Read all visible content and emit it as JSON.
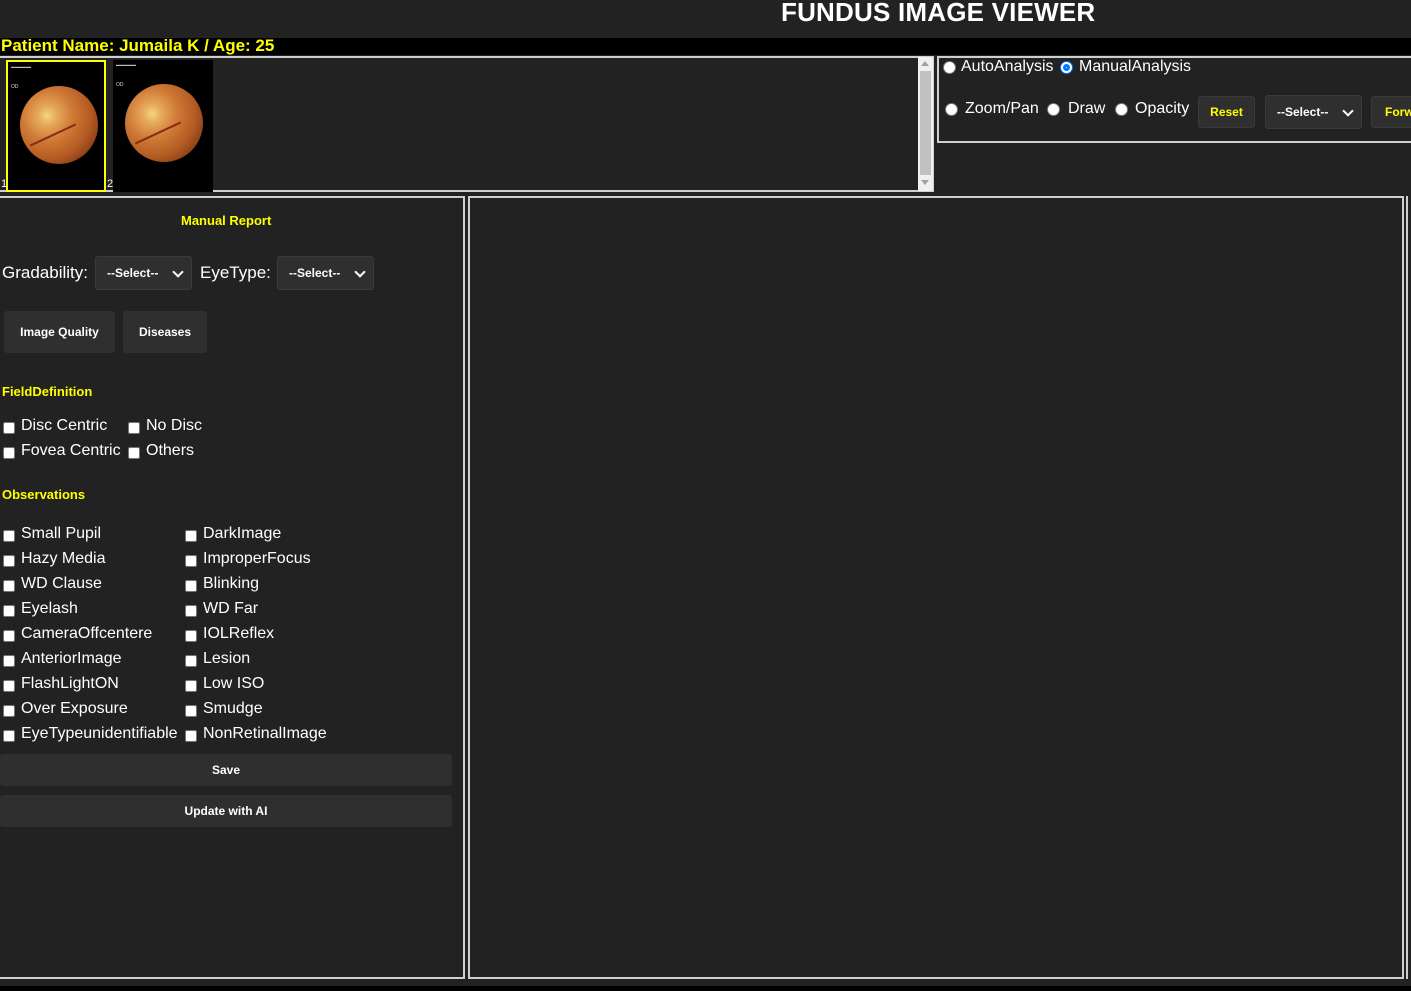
{
  "header": {
    "title": "FUNDUS IMAGE VIEWER"
  },
  "patient": {
    "text": "Patient Name: Jumaila K / Age: 25"
  },
  "thumbnails": [
    {
      "number": "1",
      "eye_label": "OD",
      "selected": true
    },
    {
      "number": "2",
      "eye_label": "OD",
      "selected": false
    }
  ],
  "toolbar": {
    "analysis_modes": [
      {
        "label": "AutoAnalysis",
        "selected": false
      },
      {
        "label": "ManualAnalysis",
        "selected": true
      }
    ],
    "tools": [
      {
        "label": "Zoom/Pan",
        "selected": false
      },
      {
        "label": "Draw",
        "selected": false
      },
      {
        "label": "Opacity",
        "selected": false
      }
    ],
    "reset_label": "Reset",
    "select_value": "--Select--",
    "forward_label": "Forw"
  },
  "report": {
    "title": "Manual Report",
    "gradability_label": "Gradability:",
    "gradability_value": "--Select--",
    "eyetype_label": "EyeType:",
    "eyetype_value": "--Select--",
    "tabs": [
      "Image Quality",
      "Diseases"
    ],
    "field_definition_title": "FieldDefinition",
    "field_definition": [
      "Disc Centric",
      "No Disc",
      "Fovea Centric",
      "Others"
    ],
    "observations_title": "Observations",
    "observations_left": [
      "Small Pupil",
      "Hazy Media",
      "WD Clause",
      "Eyelash",
      "CameraOffcentere",
      "AnteriorImage",
      "FlashLightON",
      "Over Exposure",
      "EyeTypeunidentifiable"
    ],
    "observations_right": [
      "DarkImage",
      "ImproperFocus",
      "Blinking",
      "WD Far",
      "IOLReflex",
      "Lesion",
      "Low ISO",
      "Smudge",
      "NonRetinalImage"
    ],
    "save_label": "Save",
    "update_ai_label": "Update with AI"
  },
  "colors": {
    "accent": "#ffff00",
    "background": "#222222",
    "radio_selected": "#0075ff"
  }
}
